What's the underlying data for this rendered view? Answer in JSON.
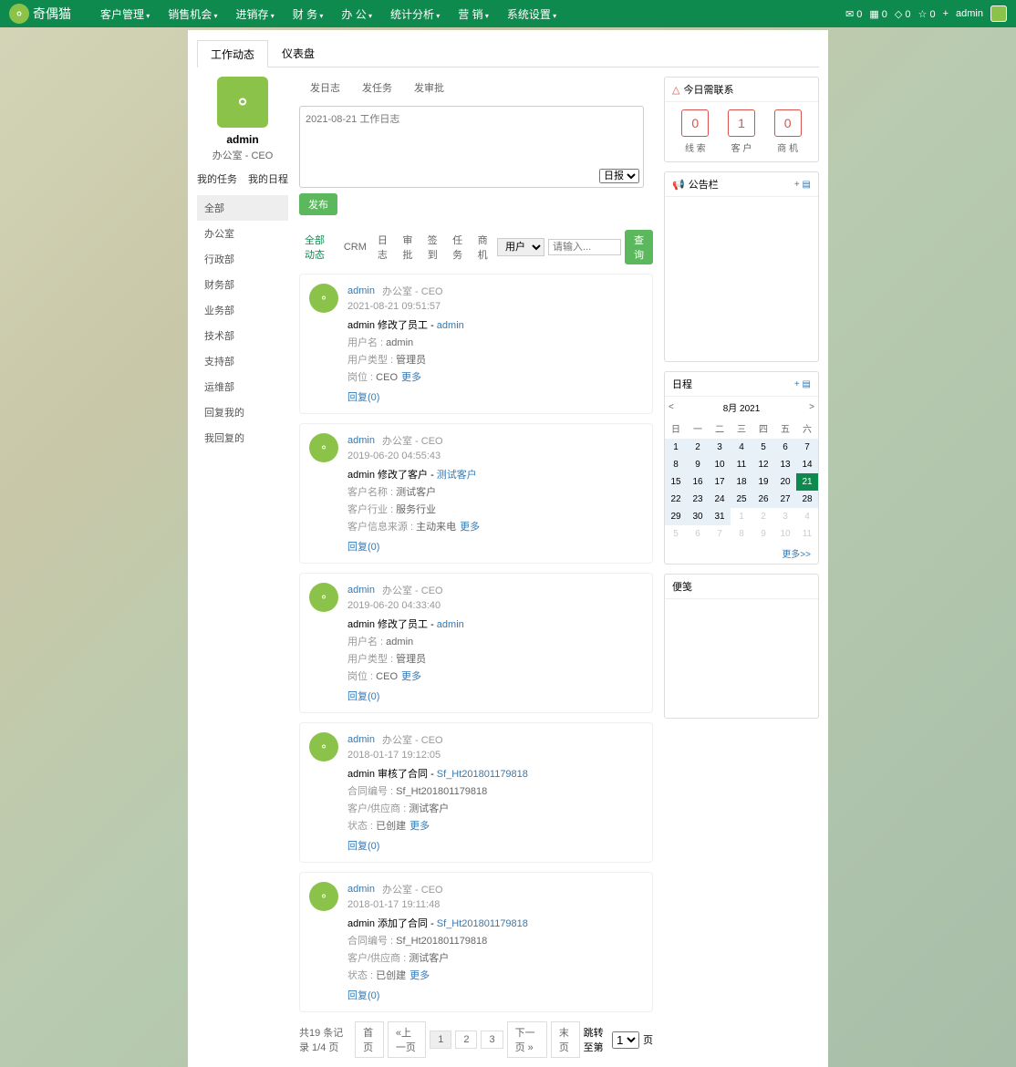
{
  "brand": "奇偶猫",
  "nav": [
    "客户管理",
    "销售机会",
    "进销存",
    "财 务",
    "办 公",
    "统计分析",
    "营 销",
    "系统设置"
  ],
  "topstats": [
    "✉ 0",
    "▦ 0",
    "◇ 0",
    "☆ 0",
    "+"
  ],
  "topuser": "admin",
  "tabs": {
    "t1": "工作动态",
    "t2": "仪表盘"
  },
  "user": {
    "name": "admin",
    "role": "办公室 - CEO"
  },
  "sidelinks": {
    "tasks": "我的任务",
    "schedule": "我的日程"
  },
  "depts": [
    "全部",
    "办公室",
    "行政部",
    "财务部",
    "业务部",
    "技术部",
    "支持部",
    "运维部",
    "回复我的",
    "我回复的"
  ],
  "post_tabs": [
    "发日志",
    "发任务",
    "发审批"
  ],
  "post_placeholder": "2021-08-21 工作日志",
  "post_type": "日报",
  "publish": "发布",
  "filter_tabs": [
    "全部动态",
    "CRM",
    "日志",
    "审批",
    "签到",
    "任务",
    "商机"
  ],
  "filter_user": "用户",
  "filter_input_ph": "请输入...",
  "search": "查询",
  "feed": [
    {
      "user": "admin",
      "dept": "办公室 - CEO",
      "time": "2021-08-21 09:51:57",
      "action": "admin 修改了员工",
      "link": "admin",
      "lines": [
        {
          "k": "用户名",
          "v": "admin"
        },
        {
          "k": "用户类型",
          "v": "管理员"
        },
        {
          "k": "岗位",
          "v": "CEO",
          "more": true
        }
      ],
      "reply": "回复(0)"
    },
    {
      "user": "admin",
      "dept": "办公室 - CEO",
      "time": "2019-06-20 04:55:43",
      "action": "admin 修改了客户",
      "link": "测试客户",
      "lines": [
        {
          "k": "客户名称",
          "v": "测试客户"
        },
        {
          "k": "客户行业",
          "v": "服务行业"
        },
        {
          "k": "客户信息来源",
          "v": "主动来电",
          "more": true
        }
      ],
      "reply": "回复(0)"
    },
    {
      "user": "admin",
      "dept": "办公室 - CEO",
      "time": "2019-06-20 04:33:40",
      "action": "admin 修改了员工",
      "link": "admin",
      "lines": [
        {
          "k": "用户名",
          "v": "admin"
        },
        {
          "k": "用户类型",
          "v": "管理员"
        },
        {
          "k": "岗位",
          "v": "CEO",
          "more": true
        }
      ],
      "reply": "回复(0)"
    },
    {
      "user": "admin",
      "dept": "办公室 - CEO",
      "time": "2018-01-17 19:12:05",
      "action": "admin 审核了合同",
      "link": "Sf_Ht201801179818",
      "lines": [
        {
          "k": "合同编号",
          "v": "Sf_Ht201801179818"
        },
        {
          "k": "客户/供应商",
          "v": "测试客户"
        },
        {
          "k": "状态",
          "v": "已创建",
          "more": true
        }
      ],
      "reply": "回复(0)"
    },
    {
      "user": "admin",
      "dept": "办公室 - CEO",
      "time": "2018-01-17 19:11:48",
      "action": "admin 添加了合同",
      "link": "Sf_Ht201801179818",
      "lines": [
        {
          "k": "合同编号",
          "v": "Sf_Ht201801179818"
        },
        {
          "k": "客户/供应商",
          "v": "测试客户"
        },
        {
          "k": "状态",
          "v": "已创建",
          "more": true
        }
      ],
      "reply": "回复(0)"
    }
  ],
  "more_text": "更多",
  "pagination": {
    "info": "共19 条记录 1/4 页",
    "first": "首页",
    "prev": "«上一页",
    "p1": "1",
    "p2": "2",
    "p3": "3",
    "next": "下一页 »",
    "last": "末页",
    "jump_label": "跳转至第",
    "jump_suffix": "页",
    "jump_val": "1"
  },
  "right": {
    "contact_title": "今日需联系",
    "contact_boxes": [
      {
        "n": "0",
        "l": "线 索"
      },
      {
        "n": "1",
        "l": "客 户"
      },
      {
        "n": "0",
        "l": "商 机"
      }
    ],
    "board_title": "公告栏",
    "board_action": "+ ▤",
    "schedule_title": "日程",
    "schedule_action": "+ ▤",
    "cal_month": "8月 2021",
    "cal_days": [
      "日",
      "一",
      "二",
      "三",
      "四",
      "五",
      "六"
    ],
    "more": "更多>>",
    "note_title": "便笺"
  }
}
